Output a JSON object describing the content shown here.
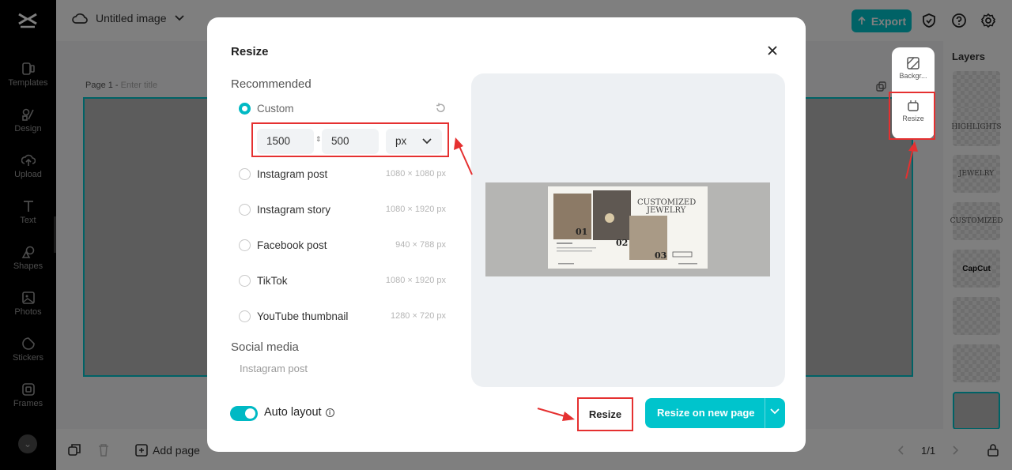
{
  "app": {
    "document_title": "Untitled image",
    "export_label": "Export"
  },
  "sidebar": {
    "items": [
      {
        "label": "Templates",
        "icon": "templates-icon"
      },
      {
        "label": "Design",
        "icon": "design-icon"
      },
      {
        "label": "Upload",
        "icon": "upload-icon"
      },
      {
        "label": "Text",
        "icon": "text-icon"
      },
      {
        "label": "Shapes",
        "icon": "shapes-icon"
      },
      {
        "label": "Photos",
        "icon": "photos-icon"
      },
      {
        "label": "Stickers",
        "icon": "stickers-icon"
      },
      {
        "label": "Frames",
        "icon": "frames-icon"
      }
    ]
  },
  "canvas": {
    "page_label": "Page 1 -",
    "title_placeholder": "Enter title"
  },
  "float_panel": {
    "background_label": "Backgr...",
    "resize_label": "Resize"
  },
  "bottom": {
    "add_page_label": "Add page",
    "page_count": "1/1"
  },
  "layers": {
    "title": "Layers",
    "thumbs": [
      "",
      "HIGHLIGHTS",
      "JEWELRY",
      "CUSTOMIZED",
      "CapCut",
      "",
      "",
      ""
    ]
  },
  "modal": {
    "title": "Resize",
    "recommended_heading": "Recommended",
    "custom_label": "Custom",
    "width_value": "1500",
    "height_value": "500",
    "unit_value": "px",
    "options": [
      {
        "label": "Instagram post",
        "dims": "1080 × 1080 px"
      },
      {
        "label": "Instagram story",
        "dims": "1080 × 1920 px"
      },
      {
        "label": "Facebook post",
        "dims": "940 × 788 px"
      },
      {
        "label": "TikTok",
        "dims": "1080 × 1920 px"
      },
      {
        "label": "YouTube thumbnail",
        "dims": "1280 × 720 px"
      }
    ],
    "social_heading": "Social media",
    "social_first": "Instagram post",
    "auto_layout_label": "Auto layout",
    "auto_layout_on": true,
    "resize_button": "Resize",
    "resize_new_button": "Resize on new page"
  },
  "preview": {
    "heading_line1": "CUSTOMIZED",
    "heading_line2": "JEWELRY",
    "num1": "01",
    "num2": "02",
    "num3": "03"
  },
  "colors": {
    "accent": "#00c4cc",
    "highlight": "#e53030",
    "overlay": "rgba(0,0,0,0.5)"
  }
}
